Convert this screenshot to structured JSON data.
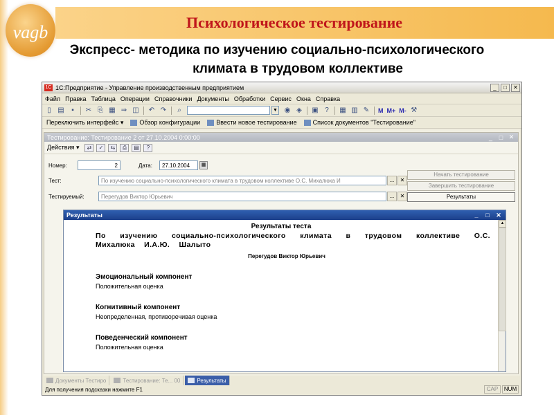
{
  "slide": {
    "logo_text": "vagb",
    "title": "Психологическое тестирование",
    "subtitle_line1": "Экспресс- методика по изучению социально-психологического",
    "subtitle_line2": "климата в трудовом коллективе"
  },
  "app": {
    "title": "1С:Предприятие - Управление производственным предприятием",
    "menu": [
      "Файл",
      "Правка",
      "Таблица",
      "Операции",
      "Справочники",
      "Документы",
      "Обработки",
      "Сервис",
      "Окна",
      "Справка"
    ],
    "toolbar2": {
      "switch_interface": "Переключить интерфейс",
      "config_overview": "Обзор конфигурации",
      "new_test": "Ввести новое тестирование",
      "doc_list": "Список документов \"Тестирование\""
    }
  },
  "doc": {
    "title": "Тестирование: Тестирование 2 от 27.10.2004 0:00:00",
    "actions": "Действия",
    "number_label": "Номер:",
    "number_value": "2",
    "date_label": "Дата:",
    "date_value": "27.10.2004",
    "test_label": "Тест:",
    "test_value": "По изучению социально-психологического климата в трудовом коллективе О.С. Михалюка И",
    "testee_label": "Тестируемый:",
    "testee_value": "Перегудов Виктор Юрьевич",
    "btn_start": "Начать тестирование",
    "btn_finish": "Завершить тестирование",
    "btn_results": "Результаты"
  },
  "results": {
    "window_title": "Результаты",
    "heading": "Результаты теста",
    "test_name": "По изучению социально-психологического климата в трудовом коллективе О.С. Михалюка И.А.Ю. Шалыто",
    "person": "Перегудов Виктор Юрьевич",
    "components": [
      {
        "name": "Эмоциональный компонент",
        "value": "Положительная оценка"
      },
      {
        "name": "Когнитивный компонент",
        "value": "Неопределенная, противоречивая оценка"
      },
      {
        "name": "Поведенческий компонент",
        "value": "Положительная оценка"
      }
    ]
  },
  "tabs": [
    "Документы Тестиро",
    "Тестирование: Те... 00",
    "Результаты"
  ],
  "status": {
    "hint": "Для получения подсказки нажмите F1",
    "cap": "CAP",
    "num": "NUM"
  },
  "colors": {
    "title_red": "#c0161b",
    "title_band": "#f5b94e",
    "results_titlebar": "#1c3f8a"
  }
}
